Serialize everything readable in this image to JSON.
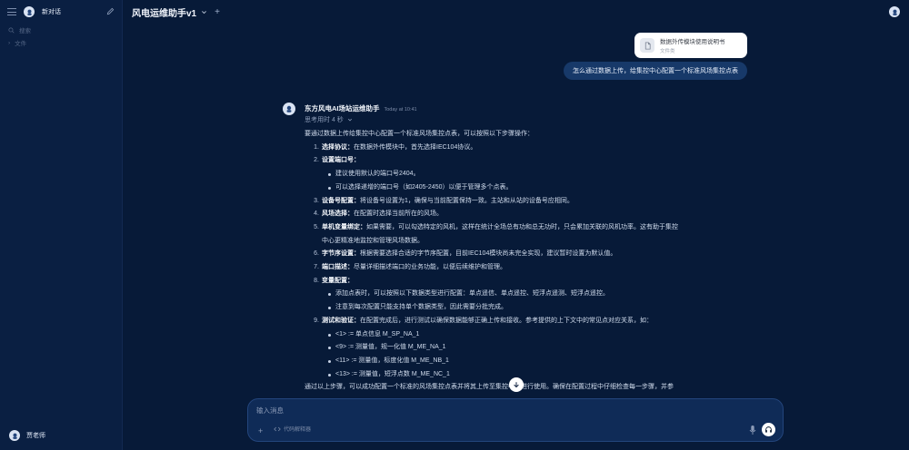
{
  "sidebar": {
    "new_chat": "新对话",
    "search": "搜索",
    "folder": "文件",
    "user_name": "贾老师"
  },
  "header": {
    "model_name": "风电运维助手v1",
    "new_tab": "+"
  },
  "file": {
    "name": "数据外传模块使用说明书",
    "type": "文件类"
  },
  "user_message": "怎么通过数据上传，给集控中心配置一个标准风场集控点表",
  "assistant": {
    "name": "东方风电AI场站运维助手",
    "time": "Today at 10:41",
    "thinking": "思考用时 4 秒",
    "intro": "要通过数据上传给集控中心配置一个标准风场集控点表，可以按照以下步骤操作：",
    "steps": [
      {
        "num": "1.",
        "title": "选择协议：",
        "text": "在数据外传模块中，首先选择IEC104协议。"
      },
      {
        "num": "2.",
        "title": "设置端口号：",
        "text": "",
        "bullets": [
          "建议使用默认的端口号2404。",
          "可以选择递增的端口号（如2405-2450）以便于管理多个点表。"
        ]
      },
      {
        "num": "3.",
        "title": "设备号配置：",
        "text": "将设备号设置为1，确保与当前配置保持一致。主站和从站的设备号应相同。"
      },
      {
        "num": "4.",
        "title": "风场选择：",
        "text": "在配置时选择当前所在的风场。"
      },
      {
        "num": "5.",
        "title": "单机变量绑定：",
        "text": "如果需要，可以勾选特定的风机，这样在统计全场总有功和总无功时，只会累加关联的风机功率。这有助于集控",
        "cont": "中心更精准地监控和管理风场数据。"
      },
      {
        "num": "6.",
        "title": "字节序设置：",
        "text": "根据需要选择合适的字节序配置，目前IEC104模块尚未完全实现，建议暂时设置为默认值。"
      },
      {
        "num": "7.",
        "title": "端口描述：",
        "text": "尽量详细描述端口的业务功能，以便后续维护和管理。"
      },
      {
        "num": "8.",
        "title": "变量配置：",
        "text": "",
        "bullets": [
          "添加点表时，可以按照以下数据类型进行配置：单点遥信、单点遥控、短浮点遥测、短浮点遥控。",
          "注意到每次配置只能支持单个数据类型，因此需要分批完成。"
        ]
      },
      {
        "num": "9.",
        "title": "测试和验证：",
        "text": "在配置完成后，进行测试以确保数据能够正确上传和接收。参考提供的上下文中的常见点对应关系，如：",
        "bullets": [
          "<1> := 单点信息 M_SP_NA_1",
          "<9> := 测量值，规一化值 M_ME_NA_1",
          "<11> := 测量值，标度化值 M_ME_NB_1",
          "<13> := 测量值，短浮点数 M_ME_NC_1"
        ]
      }
    ],
    "conclusion": "通过以上步骤，可以成功配置一个标准的风场集控点表并将其上传至集控中心进行使用。确保在配置过程中仔细检查每一步骤，并参"
  },
  "input": {
    "placeholder": "输入消息",
    "code_interpreter": "代码解释器"
  },
  "colors": {
    "background": "#071a38",
    "sidebar": "#0a1f42",
    "user_bubble": "#173969",
    "input_bg": "#0f2b57"
  }
}
